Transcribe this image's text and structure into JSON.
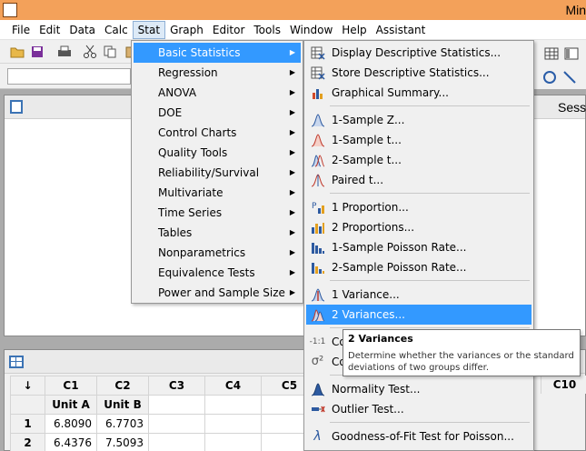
{
  "window": {
    "title": "Min"
  },
  "menubar": {
    "items": [
      {
        "label": "File"
      },
      {
        "label": "Edit"
      },
      {
        "label": "Data"
      },
      {
        "label": "Calc"
      },
      {
        "label": "Stat",
        "active": true
      },
      {
        "label": "Graph"
      },
      {
        "label": "Editor"
      },
      {
        "label": "Tools"
      },
      {
        "label": "Window"
      },
      {
        "label": "Help"
      },
      {
        "label": "Assistant"
      }
    ]
  },
  "stat_menu": {
    "items": [
      {
        "label": "Basic Statistics",
        "highlighted": true
      },
      {
        "label": "Regression"
      },
      {
        "label": "ANOVA"
      },
      {
        "label": "DOE"
      },
      {
        "label": "Control Charts"
      },
      {
        "label": "Quality Tools"
      },
      {
        "label": "Reliability/Survival"
      },
      {
        "label": "Multivariate"
      },
      {
        "label": "Time Series"
      },
      {
        "label": "Tables"
      },
      {
        "label": "Nonparametrics"
      },
      {
        "label": "Equivalence Tests"
      },
      {
        "label": "Power and Sample Size"
      }
    ]
  },
  "basic_stats_submenu": {
    "items": [
      {
        "label": "Display Descriptive Statistics...",
        "icon": "descriptive-stats-icon"
      },
      {
        "label": "Store Descriptive Statistics...",
        "icon": "store-stats-icon"
      },
      {
        "label": "Graphical Summary...",
        "icon": "graphical-summary-icon"
      },
      {
        "label": "1-Sample Z...",
        "icon": "one-sample-z-icon"
      },
      {
        "label": "1-Sample t...",
        "icon": "one-sample-t-icon"
      },
      {
        "label": "2-Sample t...",
        "icon": "two-sample-t-icon"
      },
      {
        "label": "Paired t...",
        "icon": "paired-t-icon"
      },
      {
        "label": "1 Proportion...",
        "icon": "one-proportion-icon"
      },
      {
        "label": "2 Proportions...",
        "icon": "two-proportions-icon"
      },
      {
        "label": "1-Sample Poisson Rate...",
        "icon": "one-poisson-icon"
      },
      {
        "label": "2-Sample Poisson Rate...",
        "icon": "two-poisson-icon"
      },
      {
        "label": "1 Variance...",
        "icon": "one-variance-icon"
      },
      {
        "label": "2 Variances...",
        "icon": "two-variances-icon",
        "highlighted": true
      },
      {
        "label": "Co",
        "icon": "correlation-icon"
      },
      {
        "label": "Co",
        "icon": "covariance-icon"
      },
      {
        "label": "Normality Test...",
        "icon": "normality-icon"
      },
      {
        "label": "Outlier Test...",
        "icon": "outlier-icon"
      },
      {
        "label": "Goodness-of-Fit Test for Poisson...",
        "icon": "lambda-icon"
      }
    ]
  },
  "tooltip": {
    "title": "2 Variances",
    "description": "Determine whether the variances or the standard deviations of two groups differ."
  },
  "session": {
    "title": "Sessi"
  },
  "worksheet": {
    "columns": [
      "C1",
      "C2",
      "C3",
      "C4",
      "C5"
    ],
    "column_names": [
      "Unit A",
      "Unit B"
    ],
    "right_column": "C10",
    "rows": [
      {
        "row": "1",
        "c1": "6.8090",
        "c2": "6.7703"
      },
      {
        "row": "2",
        "c1": "6.4376",
        "c2": "7.5093"
      }
    ],
    "sort_arrow": "↓"
  },
  "colors": {
    "titlebar": "#f3a15a",
    "highlight": "#3399ff"
  }
}
